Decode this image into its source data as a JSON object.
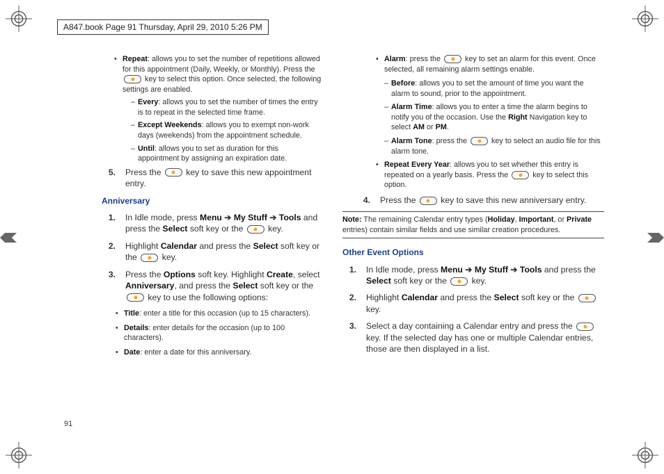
{
  "header": "A847.book  Page 91  Thursday, April 29, 2010  5:26 PM",
  "pageNum": "91",
  "left": {
    "repeat": {
      "title": "Repeat",
      "text": ": allows you to set the number of repetitions allowed for this appointment (Daily, Weekly, or Monthly). Press the ",
      "text2": " key to select this option. Once selected, the following settings are enabled."
    },
    "every": {
      "title": "Every",
      "text": ": allows you to set the number of times the entry is to repeat in the selected time frame."
    },
    "exceptW": {
      "title": "Except Weekends",
      "text": ": allows you to exempt non-work days (weekends) from the appointment schedule."
    },
    "until": {
      "title": "Until",
      "text": ": allows you to set as duration for this appointment by assigning an expiration date."
    },
    "step5": {
      "num": "5.",
      "pre": "Press the ",
      "post": " key to save this new appointment entry."
    },
    "anniversary": "Anniversary",
    "a1": {
      "num": "1.",
      "t1": "In Idle mode, press ",
      "menu": "Menu",
      "arr": " ➔ ",
      "ms": "My Stuff",
      "tools": "Tools",
      "t2": " and press the ",
      "sel": "Select",
      "t3": " soft key or the ",
      "t4": " key."
    },
    "a2": {
      "num": "2.",
      "t1": "Highlight ",
      "cal": "Calendar",
      "t2": " and press the ",
      "sel": "Select",
      "t3": " soft key or the ",
      "t4": " key."
    },
    "a3": {
      "num": "3.",
      "t1": "Press the ",
      "opt": "Options",
      "t2": " soft key. Highlight ",
      "cr": "Create",
      "t3": ", select ",
      "anv": "Anniversary",
      "t4": ", and press the ",
      "sel": "Select",
      "t5": " soft key or the ",
      "t6": " key to use the following options:"
    },
    "title": {
      "b": "Title",
      "t": ": enter a title for this occasion (up to 15 characters)."
    },
    "details": {
      "b": "Details",
      "t": ": enter details for the occasion (up to 100 characters)."
    },
    "date": {
      "b": "Date",
      "t": ": enter a date for this anniversary."
    }
  },
  "right": {
    "alarm": {
      "b": "Alarm",
      "t1": ": press the ",
      "t2": " key to set an alarm for this event. Once selected, all remaining alarm settings enable."
    },
    "before": {
      "b": "Before",
      "t": ": allows you to set the amount of time you want the alarm to sound, prior to the appointment."
    },
    "alarmTime": {
      "b": "Alarm Time",
      "t1": ": allows you to enter a time the alarm begins to notify you of the occasion. Use the ",
      "rn": "Right",
      "t2": " Navigation key to select ",
      "am": "AM",
      "or": " or ",
      "pm": "PM",
      "t3": "."
    },
    "alarmTone": {
      "b": "Alarm Tone",
      "t1": ": press the ",
      "t2": " key to select an audio file for this alarm tone."
    },
    "rey": {
      "b": "Repeat Every Year",
      "t1": ": allows you to set whether this entry is repeated on a yearly basis. Press the ",
      "t2": " key to select this option."
    },
    "step4": {
      "num": "4.",
      "pre": "Press the ",
      "post": " key to save this new anniversary entry."
    },
    "note": {
      "b": "Note:",
      "t1": " The remaining Calendar entry types (",
      "h": "Holiday",
      "c1": ", ",
      "imp": "Important",
      "c2": ", or ",
      "pr": "Private",
      "t2": " entries) contain similar fields and use similar creation procedures."
    },
    "other": "Other Event Options",
    "o1": {
      "num": "1.",
      "t1": "In Idle mode, press ",
      "menu": "Menu",
      "arr": " ➔ ",
      "ms": "My Stuff",
      "tools": "Tools",
      "t2": " and press the ",
      "sel": "Select",
      "t3": " soft key or the ",
      "t4": " key."
    },
    "o2": {
      "num": "2.",
      "t1": "Highlight ",
      "cal": "Calendar",
      "t2": " and press the ",
      "sel": "Select",
      "t3": " soft key or the ",
      "t4": " key."
    },
    "o3": {
      "num": "3.",
      "t1": "Select a day containing a Calendar entry and press the ",
      "t2": " key. If the selected day has one or multiple Calendar entries, those are then displayed in a list."
    }
  }
}
